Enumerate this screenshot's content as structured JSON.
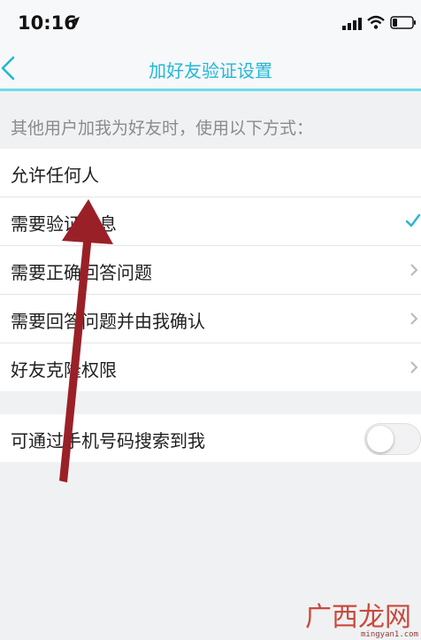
{
  "status_bar": {
    "time": "10:16",
    "icons": [
      "location-arrow-icon",
      "signal-icon",
      "wifi-icon",
      "battery-icon"
    ]
  },
  "nav": {
    "title": "加好友验证设置",
    "back_icon": "chevron-left-icon",
    "accent_color": "#21b8d8"
  },
  "section_header": "其他用户加我为好友时，使用以下方式：",
  "options": [
    {
      "label": "允许任何人",
      "accessory": "none"
    },
    {
      "label": "需要验证信息",
      "accessory": "check",
      "selected": true
    },
    {
      "label": "需要正确回答问题",
      "accessory": "chevron"
    },
    {
      "label": "需要回答问题并由我确认",
      "accessory": "chevron"
    },
    {
      "label": "好友克隆权限",
      "accessory": "chevron"
    }
  ],
  "phone_search": {
    "label": "可通过手机号码搜索到我",
    "toggle_on": false
  },
  "annotation": {
    "type": "arrow",
    "color": "#9a2027"
  },
  "watermark": {
    "text": "广西龙网",
    "url": "mingyan1.com"
  }
}
